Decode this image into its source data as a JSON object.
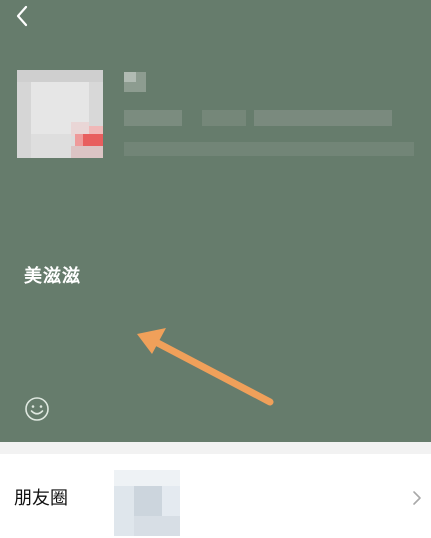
{
  "profile": {
    "signature": "美滋滋"
  },
  "moments": {
    "label": "朋友圈"
  },
  "icons": {
    "back": "chevron-left-icon",
    "emoji": "smiley-icon",
    "more": "chevron-right-icon"
  },
  "colors": {
    "profile_background": "#667c6c",
    "annotation_arrow": "#f0a05a"
  }
}
